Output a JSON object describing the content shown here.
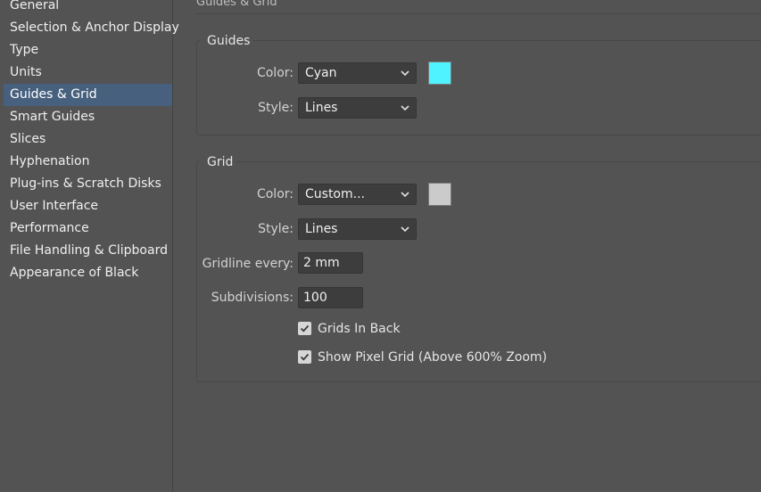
{
  "sidebar": {
    "items": [
      {
        "label": "General"
      },
      {
        "label": "Selection & Anchor Display"
      },
      {
        "label": "Type"
      },
      {
        "label": "Units"
      },
      {
        "label": "Guides & Grid",
        "selected": true
      },
      {
        "label": "Smart Guides"
      },
      {
        "label": "Slices"
      },
      {
        "label": "Hyphenation"
      },
      {
        "label": "Plug-ins & Scratch Disks"
      },
      {
        "label": "User Interface"
      },
      {
        "label": "Performance"
      },
      {
        "label": "File Handling & Clipboard"
      },
      {
        "label": "Appearance of Black"
      }
    ]
  },
  "panel": {
    "title": "Guides & Grid"
  },
  "guides": {
    "legend": "Guides",
    "color_label": "Color:",
    "color_value": "Cyan",
    "color_swatch": "#4ff3ff",
    "style_label": "Style:",
    "style_value": "Lines"
  },
  "grid": {
    "legend": "Grid",
    "color_label": "Color:",
    "color_value": "Custom...",
    "color_swatch": "#cbcbcb",
    "style_label": "Style:",
    "style_value": "Lines",
    "gridline_label": "Gridline every:",
    "gridline_value": "2 mm",
    "subdivisions_label": "Subdivisions:",
    "subdivisions_value": "100",
    "grids_in_back_label": "Grids In Back",
    "grids_in_back_checked": true,
    "pixel_grid_label": "Show Pixel Grid (Above 600% Zoom)",
    "pixel_grid_checked": true
  },
  "icons": {
    "dropdown": "chevron-down-icon",
    "check": "checkmark-icon"
  },
  "colors": {
    "background": "#535353",
    "selected_item": "#46607e"
  }
}
